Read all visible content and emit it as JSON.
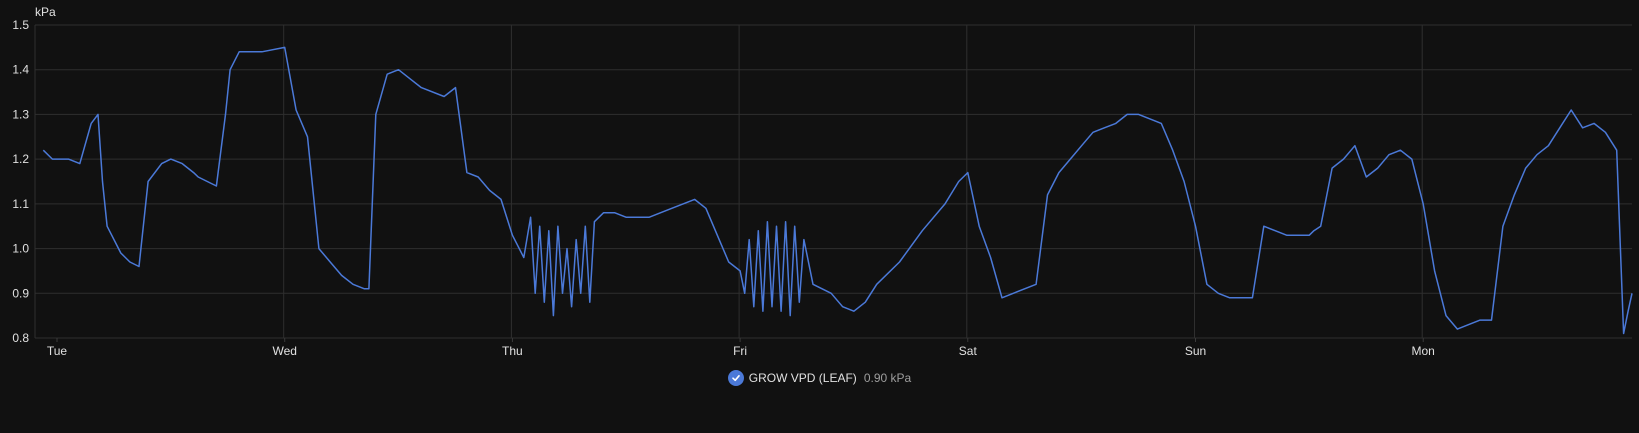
{
  "chart_data": {
    "type": "line",
    "unit_label": "kPa",
    "ylim": [
      0.8,
      1.5
    ],
    "y_ticks": [
      "0.8",
      "0.9",
      "1.0",
      "1.1",
      "1.2",
      "1.3",
      "1.4",
      "1.5"
    ],
    "x_ticks": [
      "Tue",
      "Wed",
      "Thu",
      "Fri",
      "Sat",
      "Sun",
      "Mon"
    ],
    "grid": true,
    "legend_position": "bottom-center",
    "series": [
      {
        "name": "GROW VPD (LEAF)",
        "current_value": "0.90 kPa",
        "color": "#4b79d8",
        "x_days": [
          -0.06,
          -0.02,
          0.05,
          0.1,
          0.15,
          0.18,
          0.2,
          0.22,
          0.28,
          0.32,
          0.36,
          0.4,
          0.46,
          0.5,
          0.55,
          0.6,
          0.62,
          0.66,
          0.7,
          0.74,
          0.76,
          0.78,
          0.8,
          0.9,
          1.0,
          1.05,
          1.1,
          1.15,
          1.2,
          1.25,
          1.3,
          1.35,
          1.37,
          1.4,
          1.45,
          1.5,
          1.55,
          1.6,
          1.7,
          1.75,
          1.8,
          1.85,
          1.9,
          1.95,
          2.0,
          2.05,
          2.08,
          2.1,
          2.12,
          2.14,
          2.16,
          2.18,
          2.2,
          2.22,
          2.24,
          2.26,
          2.28,
          2.3,
          2.32,
          2.34,
          2.36,
          2.4,
          2.45,
          2.5,
          2.6,
          2.7,
          2.8,
          2.85,
          2.9,
          2.95,
          3.0,
          3.02,
          3.04,
          3.06,
          3.08,
          3.1,
          3.12,
          3.14,
          3.16,
          3.18,
          3.2,
          3.22,
          3.24,
          3.26,
          3.28,
          3.32,
          3.4,
          3.45,
          3.5,
          3.55,
          3.6,
          3.7,
          3.8,
          3.9,
          3.96,
          4.0,
          4.05,
          4.1,
          4.15,
          4.2,
          4.3,
          4.35,
          4.4,
          4.45,
          4.5,
          4.55,
          4.6,
          4.65,
          4.7,
          4.75,
          4.8,
          4.85,
          4.9,
          4.95,
          5.0,
          5.05,
          5.1,
          5.15,
          5.25,
          5.3,
          5.35,
          5.4,
          5.45,
          5.5,
          5.52,
          5.55,
          5.6,
          5.65,
          5.7,
          5.75,
          5.8,
          5.85,
          5.9,
          5.95,
          6.0,
          6.05,
          6.1,
          6.15,
          6.2,
          6.25,
          6.3,
          6.35,
          6.4,
          6.45,
          6.5,
          6.55,
          6.6,
          6.65,
          6.7,
          6.75,
          6.8,
          6.85,
          6.88,
          6.9,
          6.92
        ],
        "y_values": [
          1.22,
          1.2,
          1.2,
          1.19,
          1.28,
          1.3,
          1.15,
          1.05,
          0.99,
          0.97,
          0.96,
          1.15,
          1.19,
          1.2,
          1.19,
          1.17,
          1.16,
          1.15,
          1.14,
          1.3,
          1.4,
          1.42,
          1.44,
          1.44,
          1.45,
          1.31,
          1.25,
          1.0,
          0.97,
          0.94,
          0.92,
          0.91,
          0.91,
          1.3,
          1.39,
          1.4,
          1.38,
          1.36,
          1.34,
          1.36,
          1.17,
          1.16,
          1.13,
          1.11,
          1.03,
          0.98,
          1.07,
          0.9,
          1.05,
          0.88,
          1.04,
          0.85,
          1.05,
          0.9,
          1.0,
          0.87,
          1.02,
          0.9,
          1.05,
          0.88,
          1.06,
          1.08,
          1.08,
          1.07,
          1.07,
          1.09,
          1.11,
          1.09,
          1.03,
          0.97,
          0.95,
          0.9,
          1.02,
          0.87,
          1.04,
          0.86,
          1.06,
          0.87,
          1.05,
          0.86,
          1.06,
          0.85,
          1.05,
          0.88,
          1.02,
          0.92,
          0.9,
          0.87,
          0.86,
          0.88,
          0.92,
          0.97,
          1.04,
          1.1,
          1.15,
          1.17,
          1.05,
          0.98,
          0.89,
          0.9,
          0.92,
          1.12,
          1.17,
          1.2,
          1.23,
          1.26,
          1.27,
          1.28,
          1.3,
          1.3,
          1.29,
          1.28,
          1.22,
          1.15,
          1.05,
          0.92,
          0.9,
          0.89,
          0.89,
          1.05,
          1.04,
          1.03,
          1.03,
          1.03,
          1.04,
          1.05,
          1.18,
          1.2,
          1.23,
          1.16,
          1.18,
          1.21,
          1.22,
          1.2,
          1.1,
          0.95,
          0.85,
          0.82,
          0.83,
          0.84,
          0.84,
          1.05,
          1.12,
          1.18,
          1.21,
          1.23,
          1.27,
          1.31,
          1.27,
          1.28,
          1.26,
          1.22,
          0.81,
          0.86,
          0.9
        ]
      }
    ]
  }
}
